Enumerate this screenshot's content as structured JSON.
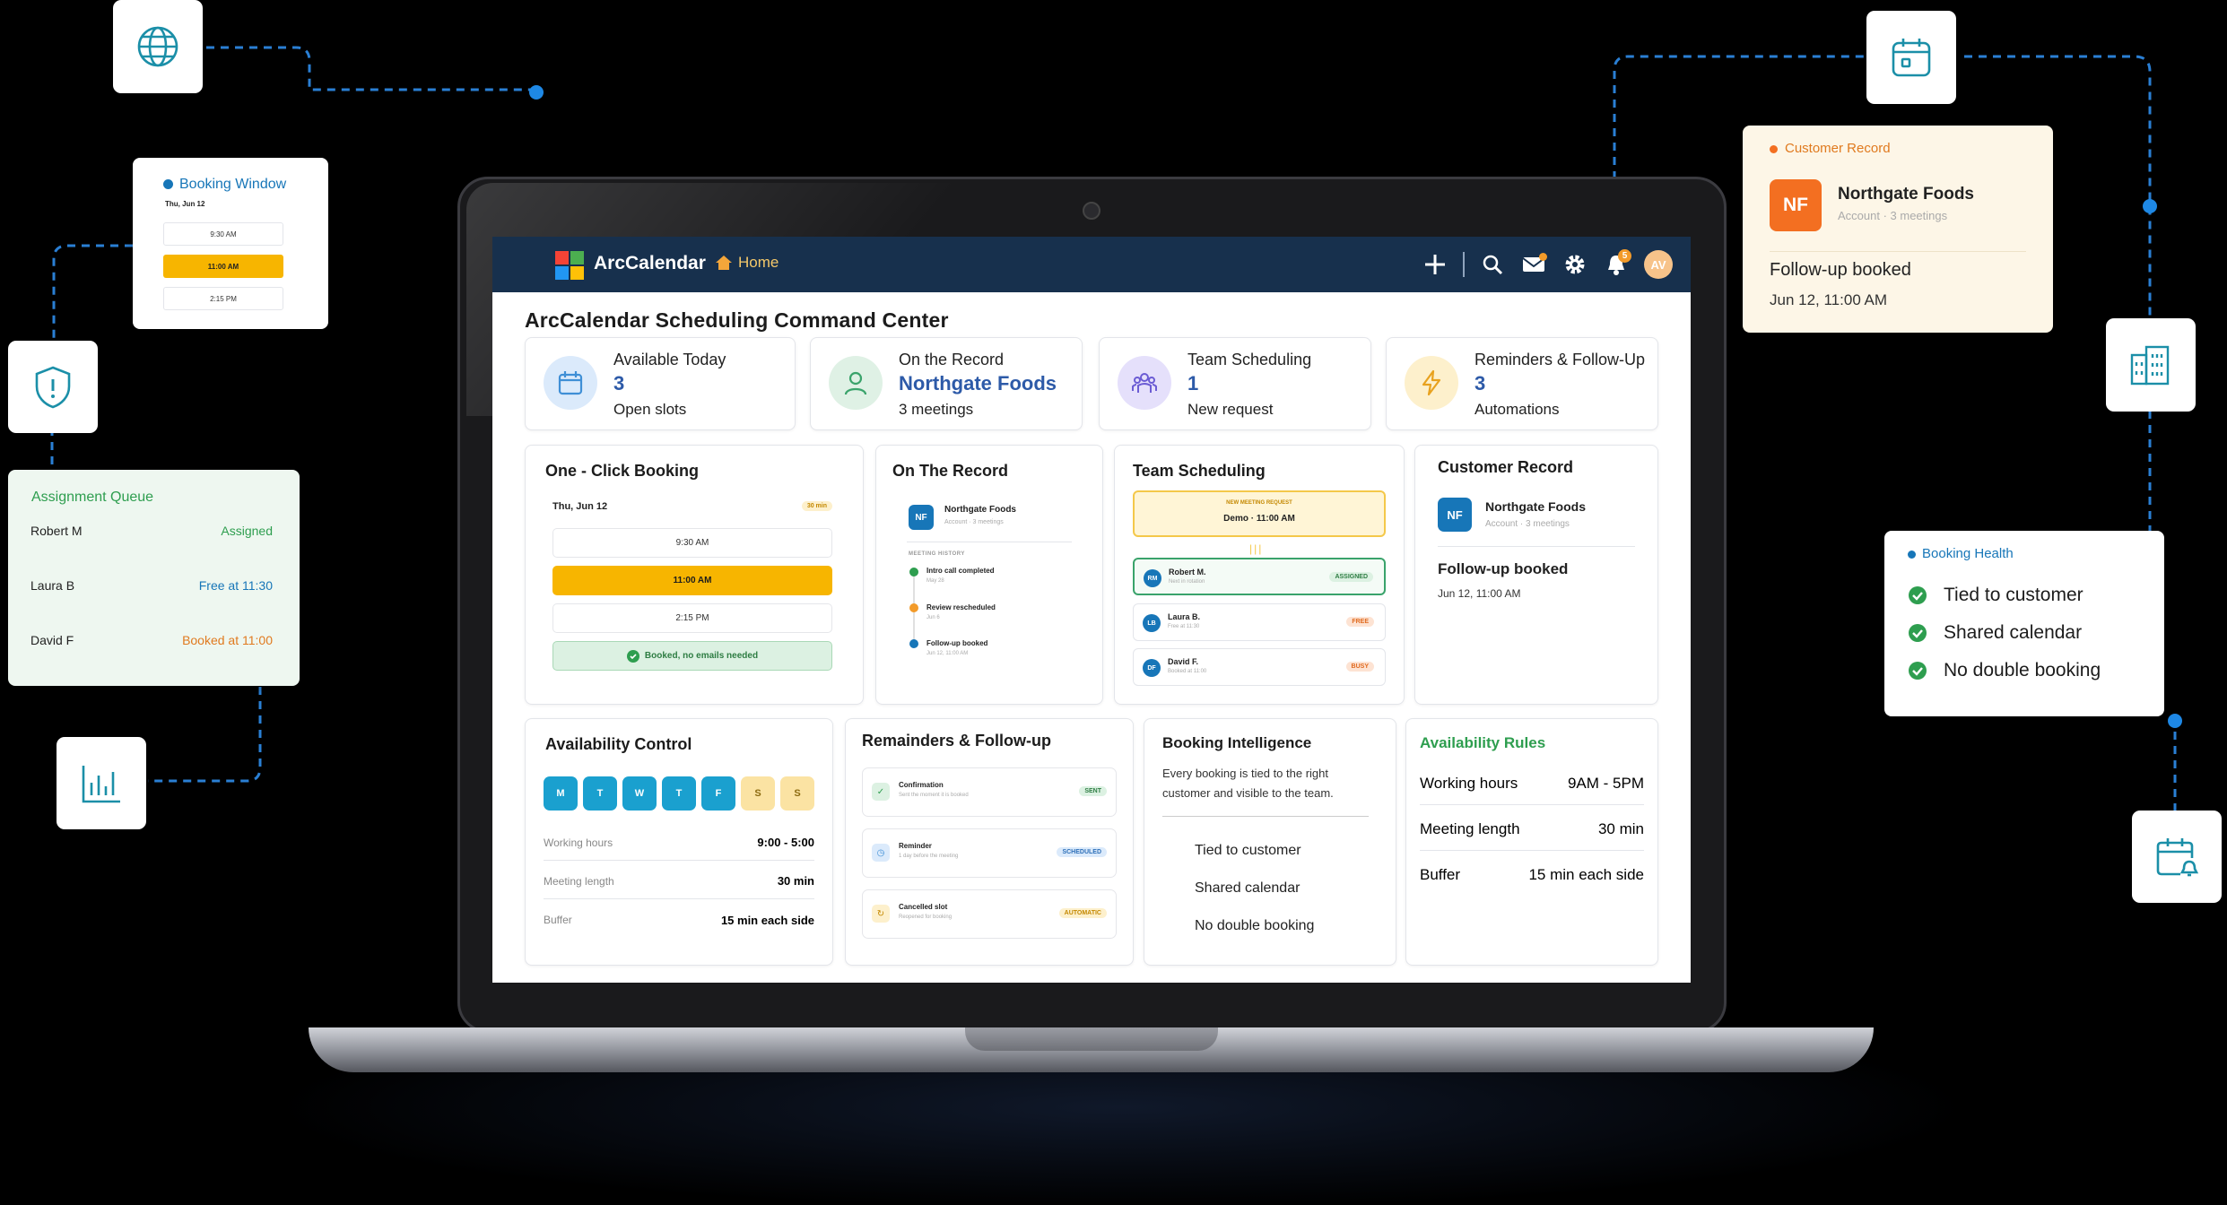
{
  "app": {
    "brand": "ArcCalendar",
    "home_label": "Home",
    "avatar_initials": "AV",
    "notification_count": "5",
    "page_title": "ArcCalendar Scheduling Command Center"
  },
  "stats": [
    {
      "label": "Available Today",
      "value": "3",
      "sub": "Open slots",
      "icon": "calendar-icon",
      "color": "#3f8fd6"
    },
    {
      "label": "On the Record",
      "value": "Northgate Foods",
      "sub": "3 meetings",
      "icon": "user-icon",
      "color": "#3aa36b"
    },
    {
      "label": "Team Scheduling",
      "value": "1",
      "sub": "New request",
      "icon": "team-icon",
      "color": "#6b5cd4"
    },
    {
      "label": "Reminders & Follow-Up",
      "value": "3",
      "sub": "Automations",
      "icon": "lightning-icon",
      "color": "#e8a21f"
    }
  ],
  "booking": {
    "title": "One - Click Booking",
    "date": "Thu, Jun 12",
    "duration": "30 min",
    "slots": [
      "9:30 AM",
      "11:00 AM",
      "2:15 PM"
    ],
    "confirm": "Booked, no emails needed"
  },
  "record": {
    "title": "On The Record",
    "company": "Northgate Foods",
    "company_sub": "Account · 3 meetings",
    "initials": "NF",
    "history_label": "MEETING HISTORY",
    "events": [
      {
        "title": "Intro call completed",
        "sub": "May 28"
      },
      {
        "title": "Review rescheduled",
        "sub": "Jun 6"
      },
      {
        "title": "Follow-up booked",
        "sub": "Jun 12, 11:00 AM"
      }
    ]
  },
  "team": {
    "title": "Team Scheduling",
    "request_label": "NEW MEETING REQUEST",
    "request_value": "Demo · 11:00 AM",
    "members": [
      {
        "initials": "RM",
        "name": "Robert M.",
        "sub": "Next in rotation",
        "status": "ASSIGNED"
      },
      {
        "initials": "LB",
        "name": "Laura B.",
        "sub": "Free at 11:30",
        "status": "FREE"
      },
      {
        "initials": "DF",
        "name": "David F.",
        "sub": "Booked at 11:00",
        "status": "BUSY"
      }
    ]
  },
  "customer": {
    "title": "Customer Record",
    "company": "Northgate Foods",
    "sub": "Account · 3 meetings",
    "initials": "NF",
    "event": "Follow-up booked",
    "when": "Jun 12, 11:00 AM"
  },
  "availability": {
    "title": "Availability Control",
    "days": [
      "M",
      "T",
      "W",
      "T",
      "F",
      "S",
      "S"
    ],
    "rows": [
      {
        "k": "Working hours",
        "v": "9:00 - 5:00"
      },
      {
        "k": "Meeting length",
        "v": "30 min"
      },
      {
        "k": "Buffer",
        "v": "15 min each side"
      }
    ]
  },
  "reminders": {
    "title": "Remainders & Follow-up",
    "items": [
      {
        "title": "Confirmation",
        "sub": "Sent the moment it is booked",
        "status": "SENT"
      },
      {
        "title": "Reminder",
        "sub": "1 day before the meeting",
        "status": "SCHEDULED"
      },
      {
        "title": "Cancelled slot",
        "sub": "Reopened for booking",
        "status": "AUTOMATIC"
      }
    ]
  },
  "intel": {
    "title": "Booking Intelligence",
    "body": "Every booking is tied to the right customer and visible to the team.",
    "items": [
      "Tied to customer",
      "Shared calendar",
      "No double booking"
    ]
  },
  "rules": {
    "title": "Availability Rules",
    "rows": [
      {
        "k": "Working hours",
        "v": "9AM - 5PM"
      },
      {
        "k": "Meeting length",
        "v": "30 min"
      },
      {
        "k": "Buffer",
        "v": "15 min each side"
      }
    ]
  },
  "float_booking": {
    "title": "Booking Window",
    "date": "Thu, Jun 12",
    "slots": [
      "9:30 AM",
      "11:00 AM",
      "2:15 PM"
    ]
  },
  "float_queue": {
    "title": "Assignment Queue",
    "rows": [
      {
        "name": "Robert M",
        "status": "Assigned"
      },
      {
        "name": "Laura B",
        "status": "Free at 11:30"
      },
      {
        "name": "David F",
        "status": "Booked at 11:00"
      }
    ]
  },
  "float_customer": {
    "title": "Customer Record",
    "company": "Northgate Foods",
    "sub": "Account · 3 meetings",
    "initials": "NF",
    "event": "Follow-up booked",
    "when": "Jun 12, 11:00 AM"
  },
  "float_health": {
    "title": "Booking Health",
    "items": [
      "Tied to customer",
      "Shared calendar",
      "No double booking"
    ]
  },
  "colors": {
    "navy": "#17304d",
    "accent_yellow": "#f7b500",
    "accent_orange": "#f36f21",
    "green": "#2e9e4f",
    "blue": "#1776b8"
  }
}
